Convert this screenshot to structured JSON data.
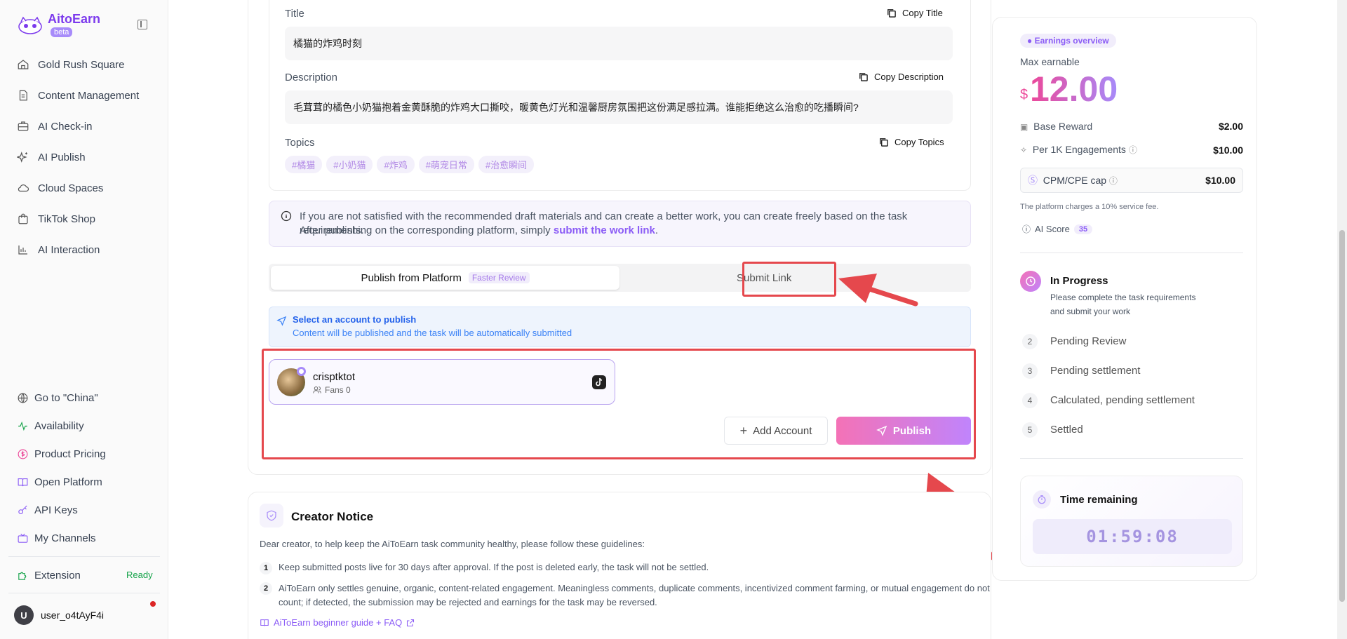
{
  "app": {
    "logo": "AitoEarn",
    "badge": "beta"
  },
  "sidebar": {
    "items": [
      {
        "label": "Gold Rush Square",
        "icon": "home-icon"
      },
      {
        "label": "Content Management",
        "icon": "document-icon"
      },
      {
        "label": "AI Check-in",
        "icon": "briefcase-icon"
      },
      {
        "label": "AI Publish",
        "icon": "sparkles-icon"
      },
      {
        "label": "Cloud Spaces",
        "icon": "cloud-icon"
      },
      {
        "label": "TikTok Shop",
        "icon": "shopping-bag-icon"
      },
      {
        "label": "AI Interaction",
        "icon": "bar-chart-icon"
      }
    ],
    "bottom": [
      {
        "label": "Go to \"China\"",
        "icon": "globe-icon"
      },
      {
        "label": "Availability",
        "icon": "activity-icon"
      },
      {
        "label": "Product Pricing",
        "icon": "dollar-circle-icon"
      },
      {
        "label": "Open Platform",
        "icon": "book-icon"
      },
      {
        "label": "API Keys",
        "icon": "key-icon"
      },
      {
        "label": "My Channels",
        "icon": "tv-icon"
      }
    ],
    "extension": {
      "label": "Extension",
      "status": "Ready"
    },
    "user": {
      "initial": "U",
      "name": "user_o4tAyF4i"
    }
  },
  "draft": {
    "title_label": "Title",
    "copy_title": "Copy Title",
    "title_value": "橘猫的炸鸡时刻",
    "description_label": "Description",
    "copy_description": "Copy Description",
    "description_value": "毛茸茸的橘色小奶猫抱着金黄酥脆的炸鸡大口撕咬，暖黄色灯光和温馨厨房氛围把这份满足感拉满。谁能拒绝这么治愈的吃播瞬间?",
    "topics_label": "Topics",
    "copy_topics": "Copy Topics",
    "topics": [
      "#橘猫",
      "#小奶猫",
      "#炸鸡",
      "#萌宠日常",
      "#治愈瞬间"
    ]
  },
  "notice": {
    "line1": "If you are not satisfied with the recommended draft materials and can create a better work, you can create freely based on the task requirements.",
    "line2_prefix": "After publishing on the corresponding platform, simply ",
    "line2_link": "submit the work link",
    "line2_suffix": "."
  },
  "publish_tabs": {
    "platform": "Publish from Platform",
    "platform_badge": "Faster Review",
    "submit": "Submit Link"
  },
  "select_account": {
    "title": "Select an account to publish",
    "subtitle": "Content will be published and the task will be automatically submitted"
  },
  "account": {
    "name": "crisptktot",
    "fans": "Fans 0"
  },
  "buttons": {
    "add_account": "Add Account",
    "publish": "Publish"
  },
  "creator_notice": {
    "title": "Creator Notice",
    "intro": "Dear creator, to help keep the AiToEarn task community healthy, please follow these guidelines:",
    "items": [
      {
        "num": "1",
        "text": "Keep submitted posts live for 30 days after approval. If the post is deleted early, the task will not be settled."
      },
      {
        "num": "2",
        "text_line1": "AiToEarn only settles genuine, organic, content-related engagement. Meaningless comments, duplicate comments, incentivized comment farming, or mutual engagement do not",
        "text_line2": "count; if detected, the submission may be rejected and earnings for the task may be reversed."
      }
    ],
    "faq_link": "AiToEarn beginner guide + FAQ"
  },
  "earnings": {
    "badge": "Earnings overview",
    "max_label": "Max earnable",
    "currency": "$",
    "max_value": "12.00",
    "base_label": "Base Reward",
    "base_value": "$2.00",
    "per1k_label": "Per 1K Engagements",
    "per1k_value": "$10.00",
    "cap_label": "CPM/CPE cap",
    "cap_value": "$10.00",
    "fee_note": "The platform charges a 10% service fee.",
    "ai_score_label": "AI Score",
    "ai_score_value": "35"
  },
  "progress": {
    "current": {
      "title": "In Progress",
      "desc_line1": "Please complete the task requirements",
      "desc_line2": "and submit your work"
    },
    "steps": [
      {
        "num": "2",
        "label": "Pending Review"
      },
      {
        "num": "3",
        "label": "Pending settlement"
      },
      {
        "num": "4",
        "label": "Calculated, pending settlement"
      },
      {
        "num": "5",
        "label": "Settled"
      }
    ]
  },
  "timer": {
    "label": "Time remaining",
    "value": "01:59:08"
  },
  "colors": {
    "accent": "#8b5cf6",
    "pink": "#f472b6",
    "annotation_red": "#e5484d"
  }
}
